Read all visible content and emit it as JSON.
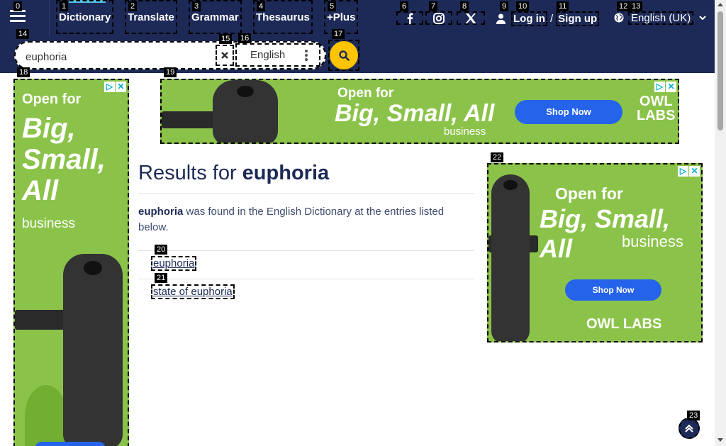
{
  "nav": {
    "items": [
      "Dictionary",
      "Translate",
      "Grammar",
      "Thesaurus",
      "+Plus"
    ],
    "login_label": "Log in",
    "separator": "/",
    "signup_label": "Sign up",
    "language_label": "English (UK)"
  },
  "social": [
    "facebook-icon",
    "instagram-icon",
    "x-twitter-icon"
  ],
  "search": {
    "value": "euphoria",
    "dictionary": "English"
  },
  "results": {
    "title_prefix": "Results for",
    "title_term": "euphoria",
    "found_term": "euphoria",
    "found_text": "was found in the English Dictionary at the entries listed below.",
    "links": [
      "euphoria",
      "state of euphoria"
    ]
  },
  "ads": {
    "open_for": "Open for",
    "big": "Big,",
    "small": "Small,",
    "all": "All",
    "big_small_all": "Big, Small, All",
    "business": "business",
    "shop_now": "Shop Now",
    "brand_line1": "OWL",
    "brand_line2": "LABS",
    "brand_full": "OWL LABS"
  },
  "badges": [
    "0",
    "1",
    "2",
    "3",
    "4",
    "5",
    "6",
    "7",
    "8",
    "9",
    "10",
    "11",
    "12",
    "13",
    "14",
    "15",
    "16",
    "17",
    "18",
    "19",
    "20",
    "21",
    "22",
    "23"
  ],
  "colors": {
    "navy": "#1d2a57",
    "accent_yellow": "#fec400",
    "ad_green": "#8bc34a",
    "shop_blue": "#2563eb"
  }
}
